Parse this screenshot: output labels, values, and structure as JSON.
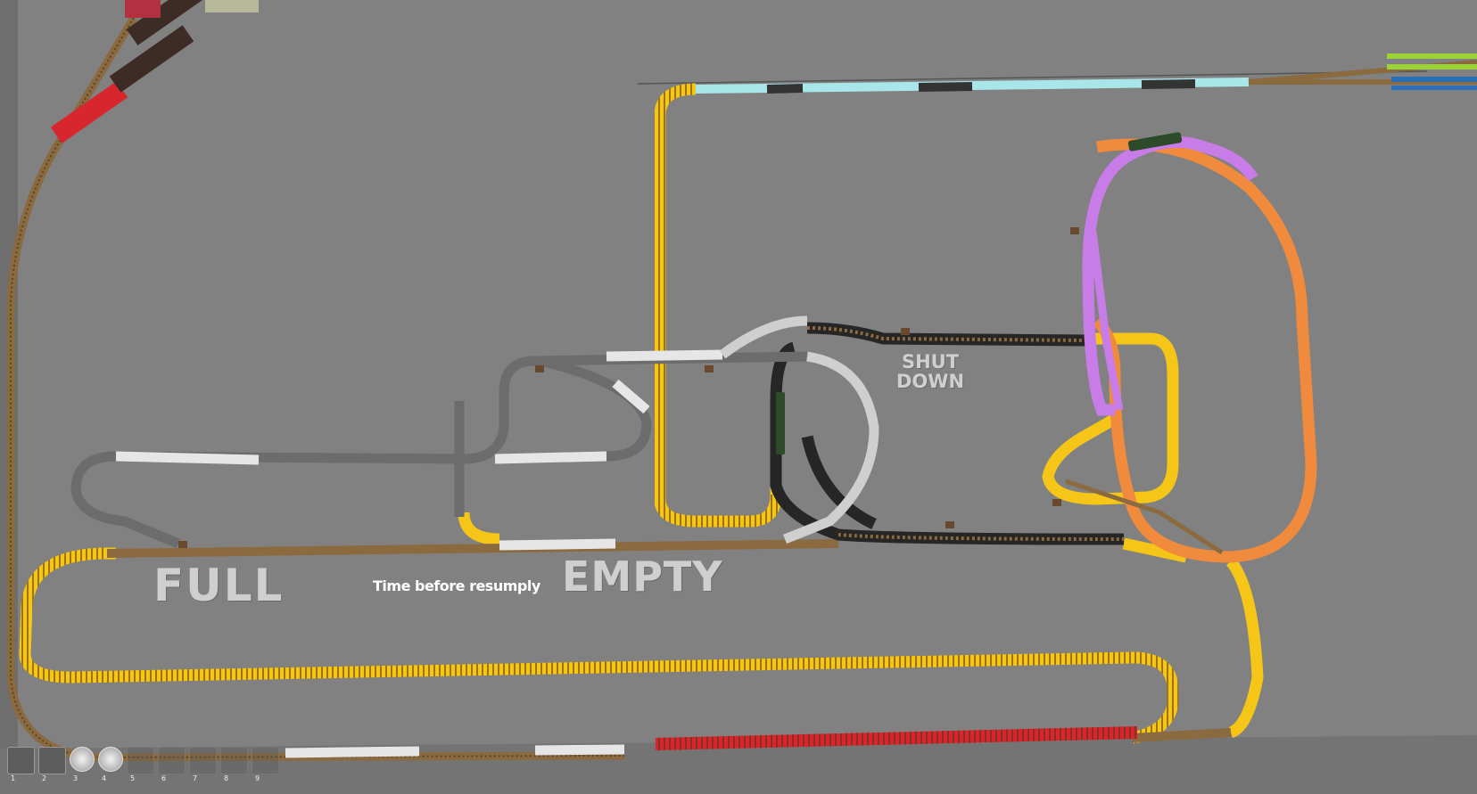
{
  "scene": {
    "labels": {
      "full": "FULL",
      "empty": "EMPTY",
      "shut_line1": "SHUT",
      "shut_line2": "DOWN",
      "time": "Time before resumply"
    },
    "track_colors": {
      "yellow": "#f5c518",
      "orange": "#f08a3c",
      "purple": "#c77ce8",
      "black": "#262626",
      "white": "#e6e6e6",
      "gray": "#6c6c6c",
      "brown": "#8a6a3e",
      "cyan": "#a9e6ea",
      "red": "#d8262e",
      "ground": "#818181"
    }
  },
  "hotbar": {
    "slots": [
      {
        "num": "1",
        "icon": "pointer-tool-icon",
        "kind": "tool"
      },
      {
        "num": "2",
        "icon": "camera-tool-icon",
        "kind": "tool"
      },
      {
        "num": "3",
        "icon": "item-orb-icon",
        "kind": "round"
      },
      {
        "num": "4",
        "icon": "item-orb-icon",
        "kind": "round"
      },
      {
        "num": "5",
        "icon": "empty-slot-icon",
        "kind": "empty"
      },
      {
        "num": "6",
        "icon": "empty-slot-icon",
        "kind": "empty"
      },
      {
        "num": "7",
        "icon": "empty-slot-icon",
        "kind": "empty"
      },
      {
        "num": "8",
        "icon": "empty-slot-icon",
        "kind": "empty"
      },
      {
        "num": "9",
        "icon": "empty-slot-icon",
        "kind": "empty"
      }
    ]
  }
}
